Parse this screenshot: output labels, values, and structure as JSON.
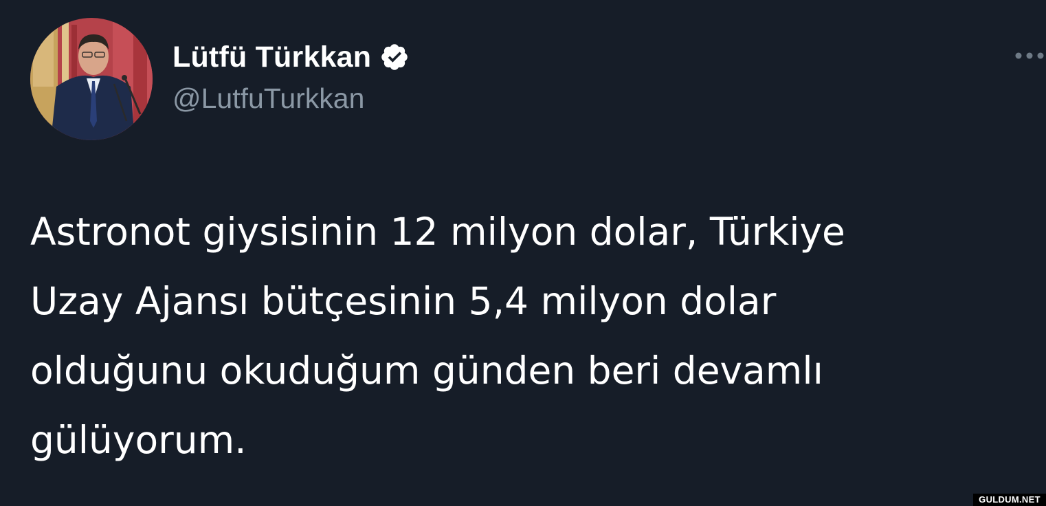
{
  "tweet": {
    "author": {
      "display_name": "Lütfü Türkkan",
      "handle": "@LutfuTurkkan",
      "verified": true,
      "avatar_icon": "profile-photo"
    },
    "more_icon": "more-options-icon",
    "text_lines": [
      "Astronot giysisinin 12 milyon dolar, Türkiye",
      "Uzay Ajansı bütçesinin 5,4 milyon dolar",
      "olduğunu okuduğum günden beri devamlı",
      "gülüyorum."
    ]
  },
  "watermark": {
    "text": "GULDUM.NET"
  },
  "colors": {
    "background": "#161d28",
    "text": "#ffffff",
    "handle": "#8b98a5",
    "verified_badge": "#ffffff"
  }
}
